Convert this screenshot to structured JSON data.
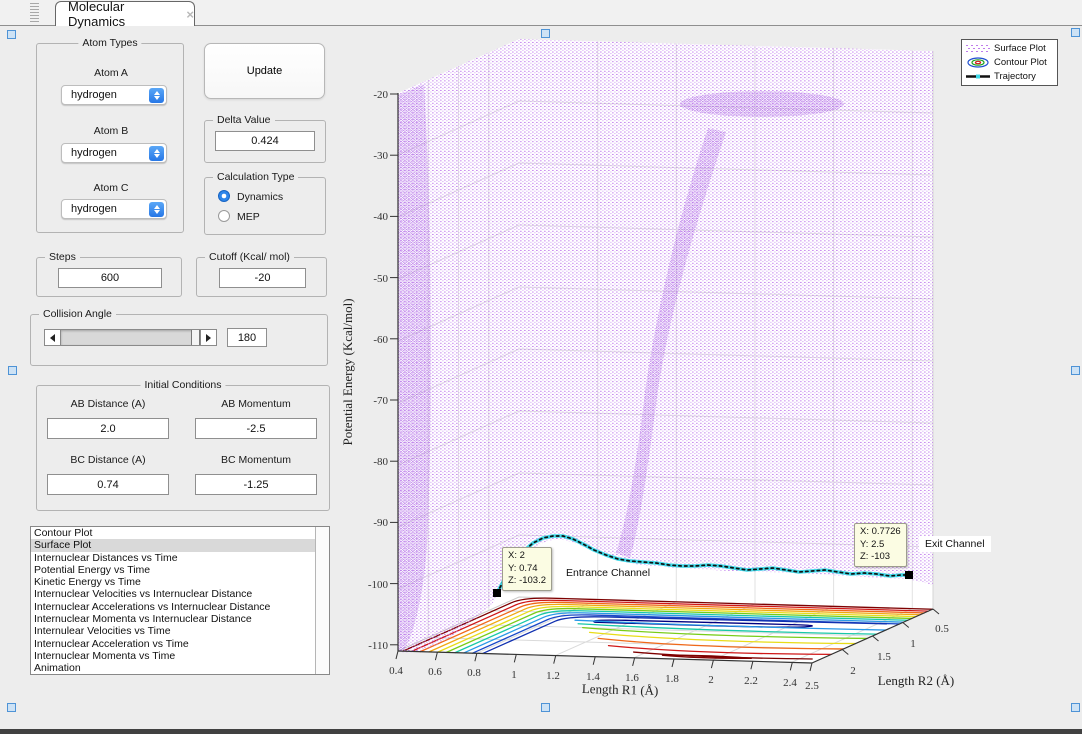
{
  "window": {
    "tab_title": "Molecular Dynamics",
    "close": "×"
  },
  "controls": {
    "atom_types": {
      "label": "Atom Types",
      "atoms": [
        {
          "label": "Atom A",
          "value": "hydrogen"
        },
        {
          "label": "Atom B",
          "value": "hydrogen"
        },
        {
          "label": "Atom C",
          "value": "hydrogen"
        }
      ]
    },
    "update": {
      "label": "Update"
    },
    "delta": {
      "label": "Delta Value",
      "value": "0.424"
    },
    "calc_type": {
      "label": "Calculation Type",
      "selected": "Dynamics",
      "options": [
        {
          "label": "Dynamics"
        },
        {
          "label": "MEP"
        }
      ]
    },
    "steps": {
      "label": "Steps",
      "value": "600"
    },
    "cutoff": {
      "label": "Cutoff (Kcal/ mol)",
      "value": "-20"
    },
    "collision_angle": {
      "label": "Collision Angle",
      "value": "180"
    },
    "initial_conditions": {
      "label": "Initial Conditions",
      "fields": [
        {
          "label": "AB Distance (A)",
          "value": "2.0"
        },
        {
          "label": "AB Momentum",
          "value": "-2.5"
        },
        {
          "label": "BC Distance (A)",
          "value": "0.74"
        },
        {
          "label": "BC Momentum",
          "value": "-1.25"
        }
      ]
    },
    "plot_list": {
      "selected": "Surface Plot",
      "items": [
        "Contour Plot",
        "Surface Plot",
        "Internuclear Distances vs Time",
        "Potential Energy vs Time",
        "Kinetic Energy vs Time",
        "Internuclear Velocities vs Internuclear Distance",
        "Internuclear Accelerations vs Internuclear Distance",
        "Internuclear Momenta vs Internuclear Distance",
        "Internulear Velocities vs Time",
        "Internuclear Acceleration vs Time",
        "Internuclear Momenta vs Time",
        "Animation"
      ]
    }
  },
  "plot": {
    "legend": {
      "items": [
        "Surface Plot",
        "Contour Plot",
        "Trajectory"
      ]
    },
    "x_axis": {
      "label": "Length R1 (Å)",
      "ticks": [
        "0.4",
        "0.6",
        "0.8",
        "1",
        "1.2",
        "1.4",
        "1.6",
        "1.8",
        "2",
        "2.2",
        "2.4",
        "2.5"
      ]
    },
    "y_axis": {
      "label": "Length R2 (Å)",
      "ticks": [
        "2",
        "1.5",
        "1",
        "0.5"
      ]
    },
    "z_axis": {
      "label": "Potential Energy (Kcal/mol)",
      "ticks": [
        "-20",
        "-30",
        "-40",
        "-50",
        "-60",
        "-70",
        "-80",
        "-90",
        "-100",
        "-110"
      ]
    },
    "datatips": {
      "entrance": {
        "lines": [
          "X: 2",
          "Y: 0.74",
          "Z: -103.2"
        ]
      },
      "exit": {
        "lines": [
          "X: 0.7726",
          "Y: 2.5",
          "Z: -103"
        ]
      }
    },
    "annotations": {
      "entrance": "Entrance Channel",
      "exit": "Exit Channel"
    },
    "colors": {
      "surface": "#bf7cec",
      "trajectory": "#3fd9e8",
      "accent_blue": "#2e86ea"
    }
  },
  "chart_data": {
    "type": "scatter",
    "subtype": "3d-surface-with-contour-and-trajectory",
    "title": "",
    "x_axis": {
      "label": "Length R1 (Å)",
      "range": [
        0.4,
        2.5
      ],
      "ticks": [
        0.4,
        0.6,
        0.8,
        1,
        1.2,
        1.4,
        1.6,
        1.8,
        2,
        2.2,
        2.4,
        2.5
      ]
    },
    "y_axis": {
      "label": "Length R2 (Å)",
      "range": [
        0.5,
        2.5
      ],
      "ticks": [
        0.5,
        1,
        1.5,
        2
      ]
    },
    "z_axis": {
      "label": "Potential Energy (Kcal/mol)",
      "range": [
        -110,
        -20
      ],
      "ticks": [
        -20,
        -30,
        -40,
        -50,
        -60,
        -70,
        -80,
        -90,
        -100,
        -110
      ]
    },
    "series": [
      {
        "name": "Surface Plot",
        "type": "dotted potential energy surface",
        "z_ceiling": -20
      },
      {
        "name": "Contour Plot",
        "type": "floor contours, L-shaped valley, rainbow levels"
      },
      {
        "name": "Trajectory",
        "type": "line",
        "start": {
          "x": 2,
          "y": 0.74,
          "z": -103.2,
          "annotation": "Entrance Channel"
        },
        "end": {
          "x": 0.7726,
          "y": 2.5,
          "z": -103,
          "annotation": "Exit Channel"
        }
      }
    ],
    "legend_position": "top-right"
  }
}
